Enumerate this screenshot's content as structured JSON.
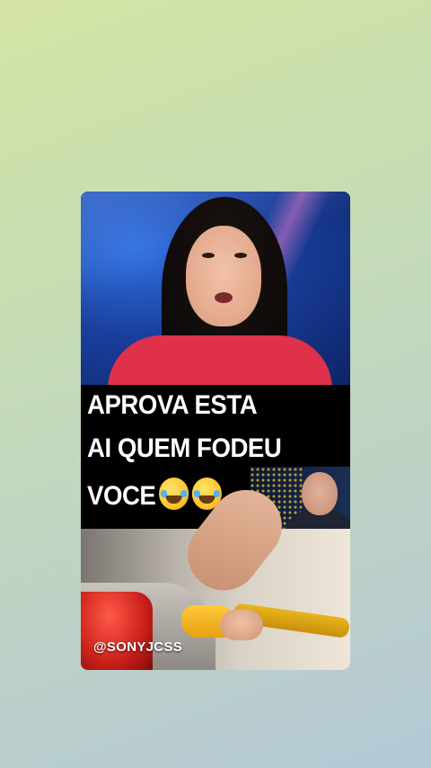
{
  "post": {
    "caption_lines": [
      "APROVA ESTA",
      "AI QUEM FODEU",
      "VOCE"
    ],
    "caption_emoji": "rolling-on-floor-laughing-emoji",
    "watermark": "@SONYJCSS"
  },
  "colors": {
    "background_top": "#d4e4a4",
    "background_bottom": "#b4c8d6",
    "caption_bg": "#000000",
    "caption_text": "#ffffff"
  }
}
